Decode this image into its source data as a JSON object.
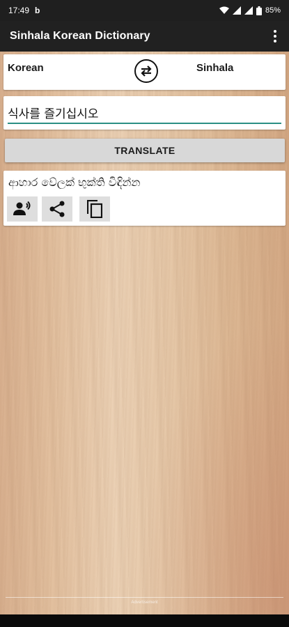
{
  "status_bar": {
    "time": "17:49",
    "notification_glyph": "b",
    "battery": "85%"
  },
  "app": {
    "title": "Sinhala Korean Dictionary"
  },
  "languages": {
    "source": "Korean",
    "target": "Sinhala"
  },
  "input": {
    "value": "식사를 즐기십시오",
    "placeholder": ""
  },
  "translate_button": {
    "label": "TRANSLATE"
  },
  "result": {
    "text": "ආහාර වේලක් භුක්ති විඳින්න"
  },
  "ad_bar": {
    "text": "Advertisement"
  },
  "icons": {
    "swap": "swap-arrows-icon",
    "speak": "speak-icon",
    "share": "share-icon",
    "copy": "copy-icon",
    "menu": "more-vert-icon"
  },
  "colors": {
    "app_bar": "#212121",
    "input_underline": "#2a8f84",
    "button": "#d8d8d8"
  }
}
